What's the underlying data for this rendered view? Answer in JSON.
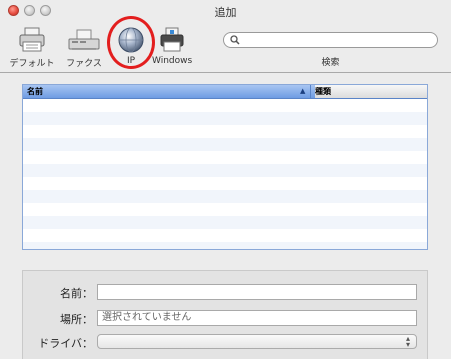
{
  "window": {
    "title": "追加"
  },
  "toolbar": {
    "default_label": "デフォルト",
    "fax_label": "ファクス",
    "ip_label": "IP",
    "windows_label": "Windows",
    "search_label": "検索",
    "search_value": ""
  },
  "list": {
    "columns": {
      "name": "名前",
      "kind": "種類"
    },
    "sort_icon": "sort-up-triangle",
    "rows": []
  },
  "form": {
    "name_label": "名前：",
    "name_value": "",
    "location_label": "場所：",
    "location_value": "選択されていません",
    "driver_label": "ドライバ：",
    "driver_value": ""
  },
  "colors": {
    "header_blue": "#6f9ce3",
    "highlight_circle": "#e31e1e",
    "window_bg": "#ececec"
  }
}
